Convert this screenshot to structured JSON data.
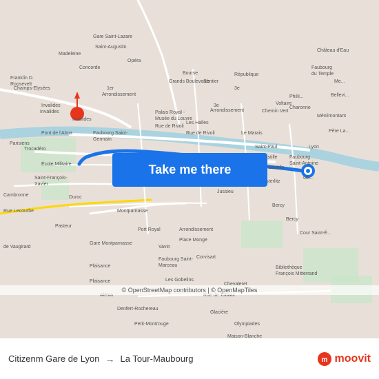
{
  "map": {
    "alt": "Map of Paris showing route from Gare de Lyon to La Tour-Maubourg"
  },
  "button": {
    "label": "Take me there"
  },
  "attribution": {
    "text": "© OpenStreetMap contributors | © OpenMapTiles"
  },
  "footer": {
    "origin": "Citizenm Gare de Lyon",
    "arrow": "→",
    "destination": "La Tour-Maubourg",
    "logo_text": "moovit"
  }
}
